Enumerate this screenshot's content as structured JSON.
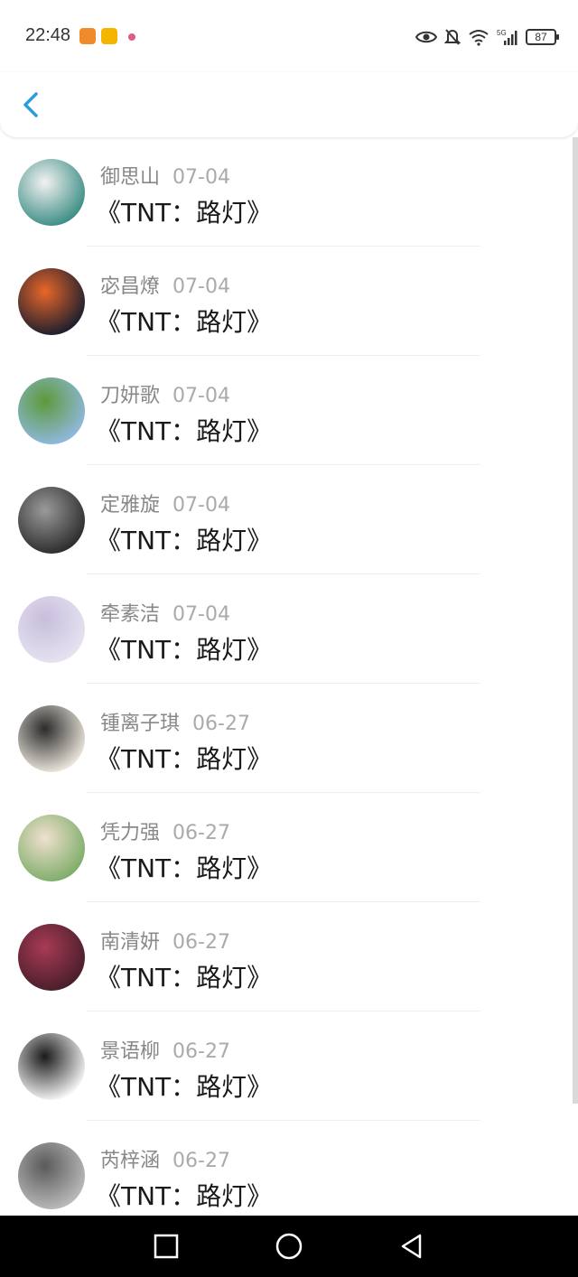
{
  "status_bar": {
    "time": "22:48",
    "battery": "87",
    "network": "5G",
    "icons": [
      "eye-icon",
      "bell-off-icon",
      "wifi-icon",
      "signal-icon"
    ]
  },
  "header": {
    "back_icon": "chevron-left-icon",
    "accent_color": "#2d9cdb"
  },
  "comments": [
    {
      "name": "御思山",
      "date": "07-04",
      "song": "《TNT：路灯》",
      "avatar_colors": [
        "#3f8f86",
        "#f2f2f2"
      ]
    },
    {
      "name": "宓昌燎",
      "date": "07-04",
      "song": "《TNT：路灯》",
      "avatar_colors": [
        "#1f1f2e",
        "#e8672a"
      ]
    },
    {
      "name": "刀妍歌",
      "date": "07-04",
      "song": "《TNT：路灯》",
      "avatar_colors": [
        "#8fb8dc",
        "#5c9a3a"
      ]
    },
    {
      "name": "定雅旋",
      "date": "07-04",
      "song": "《TNT：路灯》",
      "avatar_colors": [
        "#2e2e2e",
        "#9a9a9a"
      ]
    },
    {
      "name": "牵素洁",
      "date": "07-04",
      "song": "《TNT：路灯》",
      "avatar_colors": [
        "#e6e2f0",
        "#c7bedc"
      ]
    },
    {
      "name": "锺离子琪",
      "date": "06-27",
      "song": "《TNT：路灯》",
      "avatar_colors": [
        "#e9e4da",
        "#2b2b2b"
      ]
    },
    {
      "name": "凭力强",
      "date": "06-27",
      "song": "《TNT：路灯》",
      "avatar_colors": [
        "#7fae6a",
        "#f0e0cf"
      ]
    },
    {
      "name": "南清妍",
      "date": "06-27",
      "song": "《TNT：路灯》",
      "avatar_colors": [
        "#4a1f2b",
        "#a83a55"
      ]
    },
    {
      "name": "景语柳",
      "date": "06-27",
      "song": "《TNT：路灯》",
      "avatar_colors": [
        "#f4f4f4",
        "#1a1a1a"
      ]
    },
    {
      "name": "芮梓涵",
      "date": "06-27",
      "song": "《TNT：路灯》",
      "avatar_colors": [
        "#b9b9b9",
        "#5a5a5a"
      ]
    }
  ],
  "nav": {
    "icons": [
      "square-icon",
      "circle-icon",
      "triangle-back-icon"
    ]
  }
}
